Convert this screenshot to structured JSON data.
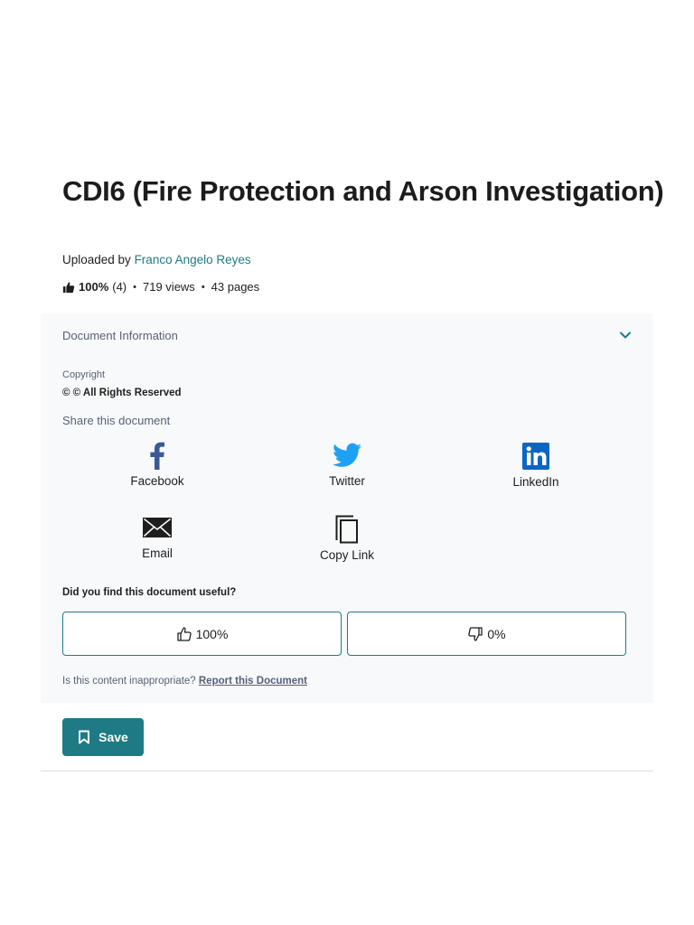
{
  "document": {
    "title": "CDI6 (Fire Protection and Arson Investigation)",
    "uploaded_prefix": "Uploaded by ",
    "uploader": "Franco Angelo Reyes",
    "rating_percent": "100%",
    "rating_count": "(4)",
    "views": "719 views",
    "pages": "43 pages",
    "stat_separator": "•"
  },
  "info_panel": {
    "toggle_label": "Document Information",
    "copyright_label": "Copyright",
    "copyright_value": "© © All Rights Reserved",
    "share_label": "Share this document",
    "share_options": [
      {
        "label": "Facebook",
        "icon": "facebook-icon",
        "color": "#3b5998"
      },
      {
        "label": "Twitter",
        "icon": "twitter-icon",
        "color": "#1da1f2"
      },
      {
        "label": "LinkedIn",
        "icon": "linkedin-icon",
        "color": "#0a66c2"
      },
      {
        "label": "Email",
        "icon": "envelope-icon",
        "color": "#1e1e1e"
      },
      {
        "label": "Copy Link",
        "icon": "copy-icon",
        "color": "#1e1e1e"
      }
    ],
    "useful_question": "Did you find this document useful?",
    "vote_up_label": "100%",
    "vote_down_label": "0%",
    "report_prefix": "Is this content inappropriate? ",
    "report_link": "Report this Document"
  },
  "actions": {
    "save_label": "Save"
  },
  "colors": {
    "accent": "#1e7b85",
    "panel_bg": "#f8f9fa",
    "muted_text": "#57617a"
  }
}
